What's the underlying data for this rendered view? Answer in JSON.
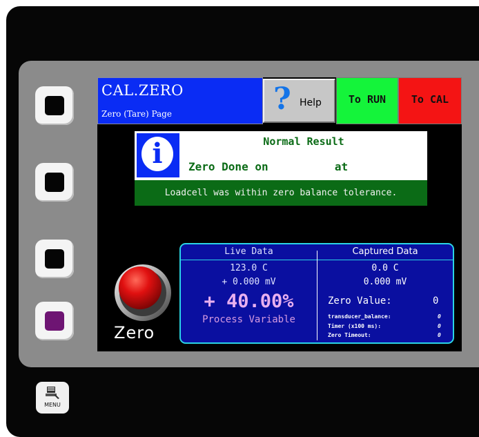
{
  "menu_key": {
    "label": "MENU",
    "icon": "menu-icon"
  },
  "softkeys": [
    {
      "color": "#050505"
    },
    {
      "color": "#050505"
    },
    {
      "color": "#050505"
    },
    {
      "color": "#6e1573"
    }
  ],
  "header": {
    "title": "CAL.ZERO",
    "subtitle": "Zero (Tare) Page",
    "help_label": "Help",
    "help_icon": "question-mark-icon",
    "run_label": "To RUN",
    "cal_label": "To CAL"
  },
  "message": {
    "icon": "info-icon",
    "heading": "Normal Result",
    "line": "Zero Done on          at",
    "detail": "Loadcell was within zero balance tolerance."
  },
  "zero_button": {
    "label": "Zero",
    "color": "#e01010"
  },
  "live_data": {
    "heading": "Live Data",
    "temperature": "123.0 C",
    "millivolts": "+ 0.000 mV",
    "process_value": "+ 40.00%",
    "process_label": "Process Variable"
  },
  "captured_data": {
    "heading": "Captured Data",
    "temperature": "0.0 C",
    "millivolts": "0.000 mV",
    "zero_value_label": "Zero Value:",
    "zero_value": "0",
    "rows": [
      {
        "label": "transducer_balance:",
        "value": "0"
      },
      {
        "label": "Timer (x100 ms):",
        "value": "0"
      },
      {
        "label": "Zero Timeout:",
        "value": "0"
      }
    ]
  },
  "colors": {
    "title_blue": "#0a2cf4",
    "run_green": "#14f43a",
    "cal_red": "#f41414",
    "result_green": "#0b6b16",
    "panel_navy": "#0a0fa0",
    "panel_border": "#2bd4e4",
    "process_pink": "#e9b0f0"
  }
}
